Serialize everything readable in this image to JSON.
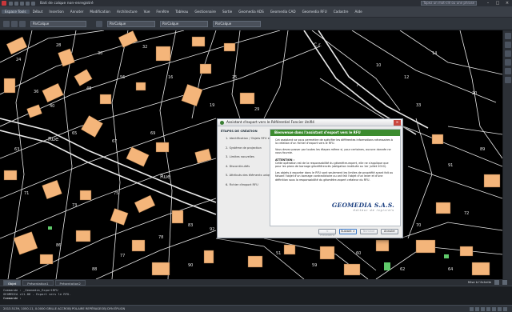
{
  "titlebar": {
    "document_title": "Bati de calque non-enregistré",
    "search_placeholder": "Tapez un mot-clé ou une phrase"
  },
  "menubar": {
    "items": [
      "Espace Tools",
      "Début",
      "Insertion",
      "Annoter",
      "Modification",
      "Architecture",
      "Vue",
      "Fenêtre",
      "Tableau",
      "Gestionnaire",
      "Sortie",
      "Geomedia ADS",
      "Geomedia CAD",
      "Geomedia RFU",
      "Cadastre",
      "Aide"
    ]
  },
  "toolbar": {
    "layer_combo": "ParCalque",
    "linetype_combo": "ParCalque",
    "lineweight_combo": "ParCalque",
    "color_combo": "ParCalque"
  },
  "dialog": {
    "title": "Assistant d'export vers le Référentiel Foncier Unifié",
    "steps_header": "ÉTAPES DE CRÉATION",
    "steps": [
      "1. Identification / Objets RFU existants",
      "2. Système de projection",
      "3. Limites nouvelles",
      "4. Discontinuités",
      "5. Attributs des éléments uniques",
      "6. Fichier d'export RFU"
    ],
    "banner": "Bienvenue dans l'assistant d'export vers le RFU",
    "paragraph1": "Cet assistant va vous permettre de spécifier les différentes informations nécessaires à la création d'un fichier d'export vers le RFU.",
    "paragraph2": "Vous devez passer par toutes les étapes même si, pour certaines, aucune donnée ne vous fournie.",
    "attention_label": "ATTENTION :",
    "paragraph3": "Cette opération est de la responsabilité du géomètre-expert, elle ne s'applique que pour les plans de bornage géoréférencés (obligation instituée au 1er juillet 2010).",
    "paragraph4": "Les objets à exporter dans le RFU sont seulement les limites de propriété ayant fait ou faisant l'objet d'un bornage contradictoire ou ont fait l'objet d'un lever et d'une définition sous la responsabilité du géomètre-expert créateur du RFU.",
    "logo_main": "GEOMEDIA S.A.S.",
    "logo_sub": "éditeur de logiciels",
    "btn_prev": "< Précédent",
    "btn_next": "Suivant >",
    "btn_finish": "Terminer",
    "btn_cancel": "Annuler"
  },
  "tabs": {
    "model": "Objet",
    "layout1": "Présentation1",
    "layout2": "Présentation2",
    "right_label": "Mise à l'échelle"
  },
  "command": {
    "history1": "Commande : _Geomedia_ExportRFU",
    "history2": "GEOMEDIA v11.06 - Export vers le RFU.",
    "prompt": "Commande :"
  },
  "status": {
    "coords": "2013.5139, 1050.11, 0.0000   GRILLE ACCROBJ POLAIRE REPÉRAGEOBJ DYN ÉPLIGN"
  },
  "map": {
    "labels": [
      "36",
      "24",
      "28",
      "30",
      "32",
      "40",
      "48",
      "56",
      "63",
      "65",
      "67",
      "69",
      "71",
      "73",
      "75",
      "77",
      "78",
      "83",
      "86",
      "88",
      "90",
      "92",
      "16",
      "19",
      "25",
      "29",
      "51",
      "59",
      "60",
      "62",
      "64",
      "70",
      "72",
      "89",
      "91",
      "7",
      "10",
      "12",
      "14",
      "20",
      "33",
      "Rue",
      "Rue",
      "C.r."
    ]
  }
}
